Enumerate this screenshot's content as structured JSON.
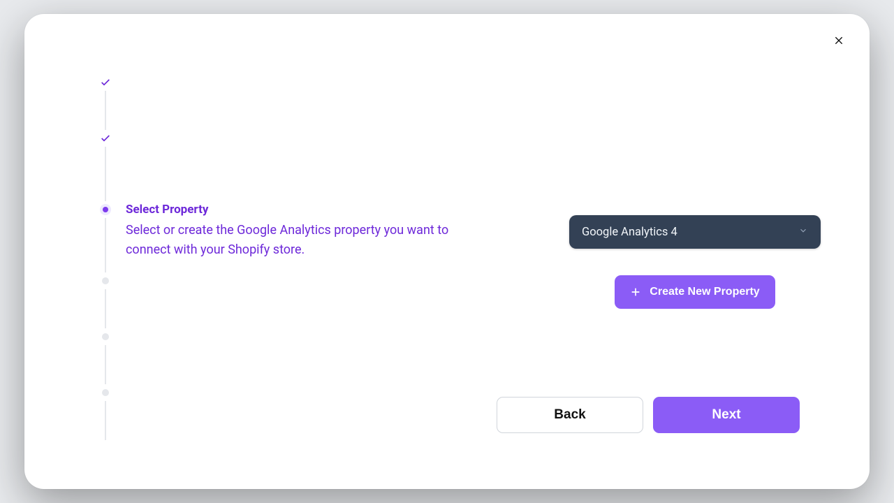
{
  "modal": {
    "close_icon": "close"
  },
  "stepper": {
    "steps": [
      {
        "state": "done"
      },
      {
        "state": "done"
      },
      {
        "state": "current",
        "title": "Select Property",
        "description": "Select or create the Google Analytics property you want to connect with your Shopify store."
      },
      {
        "state": "future"
      },
      {
        "state": "future"
      },
      {
        "state": "future"
      }
    ]
  },
  "property_select": {
    "selected": "Google Analytics 4"
  },
  "buttons": {
    "create_property": "Create New Property",
    "back": "Back",
    "next": "Next"
  },
  "colors": {
    "accent": "#8b5cf6",
    "accent_dark": "#6d28d9",
    "select_bg": "#334155"
  }
}
